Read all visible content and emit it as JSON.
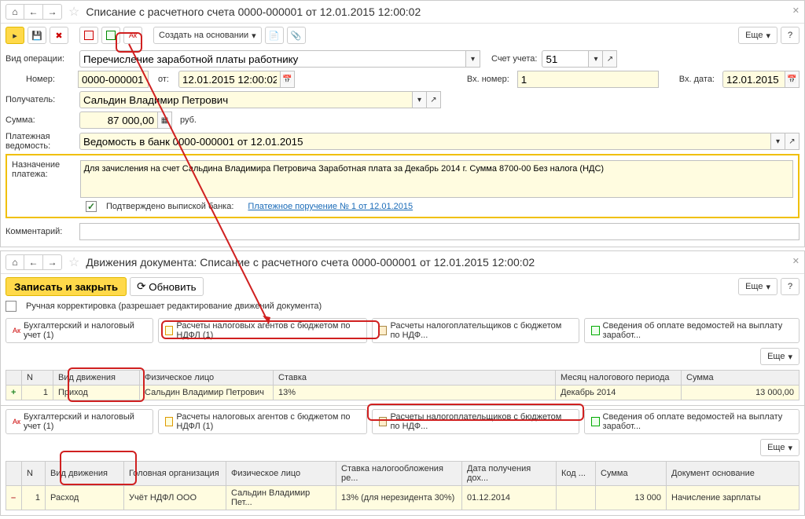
{
  "win1": {
    "title": "Списание с расчетного счета 0000-000001 от 12.01.2015 12:00:02",
    "toolbar": {
      "create_based": "Создать на основании",
      "more": "Еще"
    },
    "form": {
      "op_type_lbl": "Вид операции:",
      "op_type": "Перечисление заработной платы работнику",
      "account_lbl": "Счет учета:",
      "account": "51",
      "number_lbl": "Номер:",
      "number": "0000-000001",
      "date_lbl": "от:",
      "date": "12.01.2015 12:00:02",
      "in_number_lbl": "Вх. номер:",
      "in_number": "1",
      "in_date_lbl": "Вх. дата:",
      "in_date": "12.01.2015",
      "recipient_lbl": "Получатель:",
      "recipient": "Сальдин Владимир Петрович",
      "sum_lbl": "Сумма:",
      "sum": "87 000,00",
      "sum_cur": "руб.",
      "register_lbl": "Платежная ведомость:",
      "register": "Ведомость в банк 0000-000001 от 12.01.2015",
      "purpose_lbl": "Назначение платежа:",
      "purpose": "Для зачисления на счет Сальдина Владимира Петровича Заработная плата за Декабрь 2014 г. Сумма 8700-00 Без налога (НДС)",
      "confirmed_lbl": "Подтверждено выпиской банка:",
      "po_link": "Платежное поручение № 1 от 12.01.2015",
      "comment_lbl": "Комментарий:"
    }
  },
  "win2": {
    "title": "Движения документа: Списание с расчетного счета 0000-000001 от 12.01.2015 12:00:02",
    "save_close": "Записать и закрыть",
    "refresh": "Обновить",
    "more": "Еще",
    "manual_edit": "Ручная корректировка (разрешает редактирование движений документа)",
    "tabs": {
      "t1": "Бухгалтерский и налоговый учет (1)",
      "t2": "Расчеты налоговых агентов с бюджетом по НДФЛ (1)",
      "t3": "Расчеты налогоплательщиков с бюджетом по НДФ...",
      "t4": "Сведения об оплате ведомостей на выплату заработ..."
    },
    "table1": {
      "headers": {
        "n": "N",
        "type": "Вид движения",
        "person": "Физическое лицо",
        "rate": "Ставка",
        "month": "Месяц налогового периода",
        "sum": "Сумма"
      },
      "row": {
        "sign": "+",
        "n": "1",
        "type": "Приход",
        "person": "Сальдин Владимир Петрович",
        "rate": "13%",
        "month": "Декабрь 2014",
        "sum": "13 000,00"
      }
    },
    "tabs2": {
      "t1": "Бухгалтерский и налоговый учет (1)",
      "t2": "Расчеты налоговых агентов с бюджетом по НДФЛ (1)",
      "t3": "Расчеты налогоплательщиков с бюджетом по НДФ...",
      "t4": "Сведения об оплате ведомостей на выплату заработ..."
    },
    "table2": {
      "headers": {
        "n": "N",
        "type": "Вид движения",
        "org": "Головная организация",
        "person": "Физическое лицо",
        "rate": "Ставка налогообложения ре...",
        "date": "Дата получения дох...",
        "code": "Код ...",
        "sum": "Сумма",
        "doc": "Документ основание"
      },
      "row": {
        "sign": "–",
        "n": "1",
        "type": "Расход",
        "org": "Учёт НДФЛ ООО",
        "person": "Сальдин Владимир Пет...",
        "rate": "13% (для нерезидента 30%)",
        "date": "01.12.2014",
        "code": "",
        "sum": "13 000",
        "doc": "Начисление зарплаты"
      }
    }
  }
}
